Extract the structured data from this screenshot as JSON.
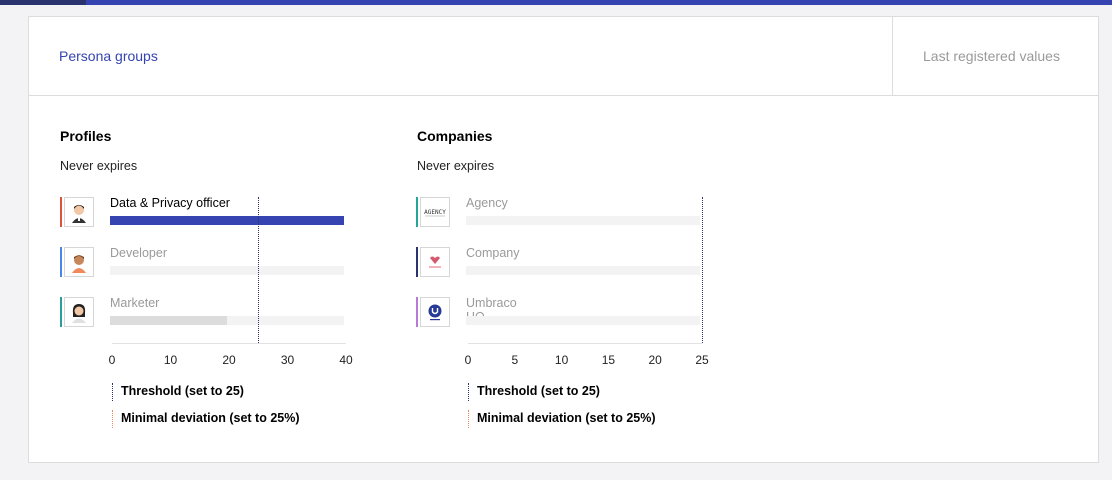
{
  "tabs": {
    "active_label": "Persona groups",
    "right_label": "Last registered values"
  },
  "colors": {
    "accent": "#3544b1",
    "threshold_line": "#2a336e",
    "deviation_line": "#f08a5d",
    "profile_bar": "#3544b1",
    "inactive_bar": "#dcdcdc"
  },
  "profiles": {
    "title": "Profiles",
    "subtitle": "Never expires",
    "items": [
      {
        "label": "Data & Privacy officer",
        "value": 40,
        "active": true,
        "marker_color": "#e0523b",
        "icon": "privacy-officer-avatar-icon"
      },
      {
        "label": "Developer",
        "value": 0,
        "active": false,
        "marker_color": "#4a86e8",
        "icon": "developer-avatar-icon"
      },
      {
        "label": "Marketer",
        "value": 20,
        "active": false,
        "marker_color": "#2aa198",
        "icon": "marketer-avatar-icon"
      }
    ]
  },
  "companies": {
    "title": "Companies",
    "subtitle": "Never expires",
    "items": [
      {
        "label": "Agency",
        "value": 0,
        "active": false,
        "marker_color": "#26a69a",
        "icon": "agency-logo-icon"
      },
      {
        "label": "Company",
        "value": 0,
        "active": false,
        "marker_color": "#2a336e",
        "icon": "company-logo-icon"
      },
      {
        "label": "Umbraco HQ",
        "value": 0,
        "active": false,
        "marker_color": "#b57bd6",
        "icon": "umbraco-logo-icon"
      }
    ]
  },
  "chart_data": [
    {
      "type": "bar",
      "title": "Profiles",
      "categories": [
        "Data & Privacy officer",
        "Developer",
        "Marketer"
      ],
      "values": [
        40,
        0,
        20
      ],
      "xlim": [
        0,
        40
      ],
      "xticks": [
        "0",
        "10",
        "20",
        "30",
        "40"
      ],
      "threshold": 25,
      "legend": [
        "Threshold (set to 25)",
        "Minimal deviation (set to 25%)"
      ]
    },
    {
      "type": "bar",
      "title": "Companies",
      "categories": [
        "Agency",
        "Company",
        "Umbraco HQ"
      ],
      "values": [
        0,
        0,
        0
      ],
      "xlim": [
        0,
        25
      ],
      "xticks": [
        "0",
        "5",
        "10",
        "15",
        "20",
        "25"
      ],
      "threshold": 25,
      "legend": [
        "Threshold (set to 25)",
        "Minimal deviation (set to 25%)"
      ]
    }
  ]
}
